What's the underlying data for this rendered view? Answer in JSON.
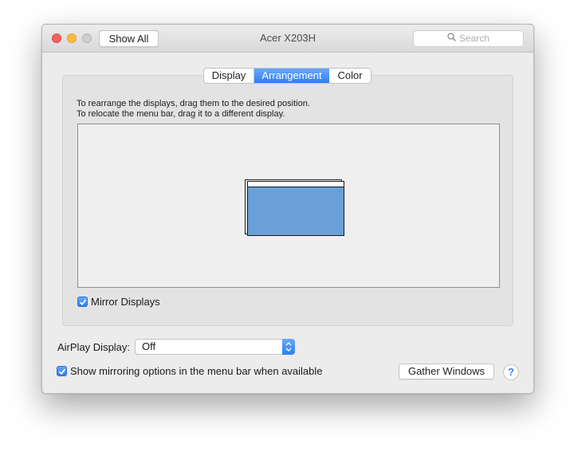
{
  "window": {
    "title": "Acer X203H",
    "show_all_label": "Show All",
    "search_placeholder": "Search"
  },
  "tabs": [
    {
      "label": "Display",
      "selected": false
    },
    {
      "label": "Arrangement",
      "selected": true
    },
    {
      "label": "Color",
      "selected": false
    }
  ],
  "arrangement": {
    "instruction_line1": "To rearrange the displays, drag them to the desired position.",
    "instruction_line2": "To relocate the menu bar, drag it to a different display.",
    "mirror_displays_label": "Mirror Displays",
    "mirror_displays_checked": true
  },
  "airplay": {
    "label": "AirPlay Display:",
    "selected_value": "Off"
  },
  "footer": {
    "show_mirroring_label": "Show mirroring options in the menu bar when available",
    "show_mirroring_checked": true,
    "gather_windows_label": "Gather Windows",
    "help_label": "?"
  },
  "colors": {
    "accent": "#2d7ef6",
    "display_fill": "#6aa0d8",
    "close": "#fc605c",
    "minimize": "#fdbc40"
  },
  "icons": [
    "close-icon",
    "minimize-icon",
    "zoom-icon",
    "search-icon",
    "checkmark-icon",
    "updown-arrows-icon",
    "help-icon"
  ]
}
